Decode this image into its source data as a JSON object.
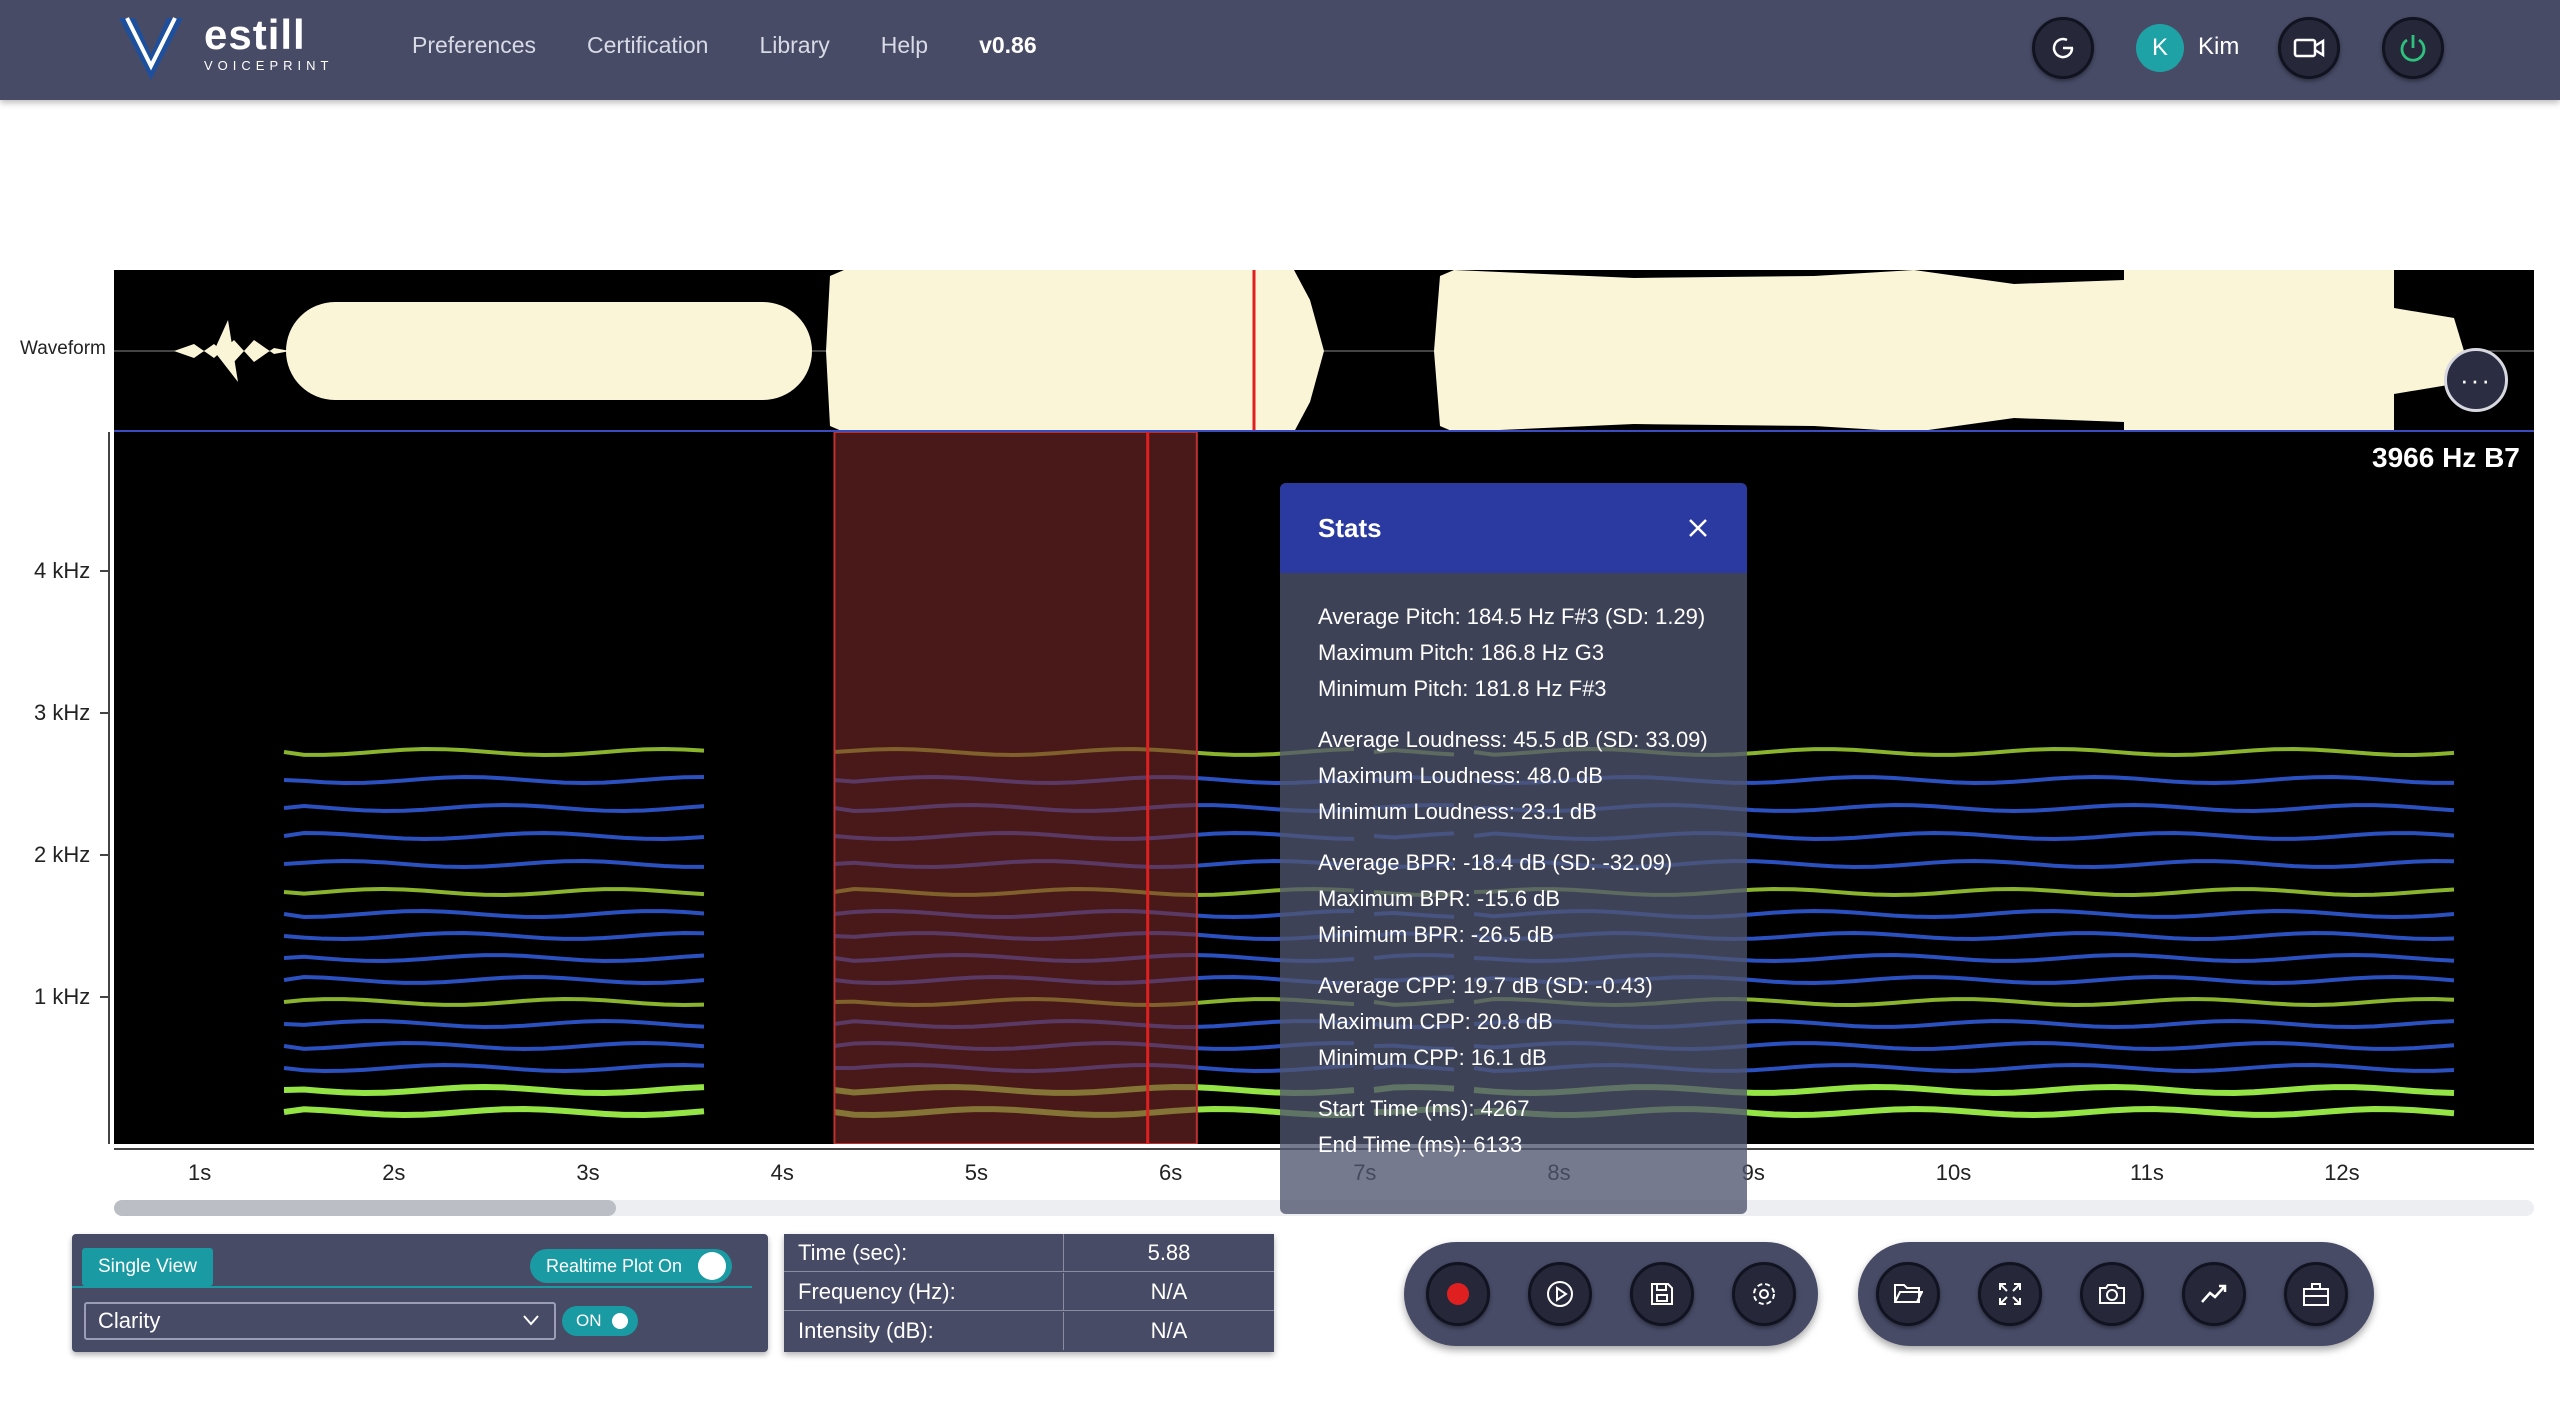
{
  "header": {
    "logo": {
      "brand": "estill",
      "sub": "VOICEPRINT"
    },
    "nav": [
      "Preferences",
      "Certification",
      "Library",
      "Help"
    ],
    "version": "v0.86",
    "user": {
      "initial": "K",
      "name": "Kim"
    },
    "icons": [
      "refresh-icon",
      "video-icon",
      "power-icon"
    ],
    "colors": {
      "header_bg": "#474b66",
      "avatar": "#1fa2a6",
      "power": "#2ec27e"
    }
  },
  "waveform": {
    "label": "Waveform",
    "more_button": "···"
  },
  "spectrogram": {
    "y_ticks": [
      "4 kHz",
      "3 kHz",
      "2 kHz",
      "1 kHz"
    ],
    "x_ticks": [
      "1s",
      "2s",
      "3s",
      "4s",
      "5s",
      "6s",
      "7s",
      "8s",
      "9s",
      "10s",
      "11s",
      "12s"
    ],
    "frequency_readout": "3966 Hz B7",
    "selection": {
      "start_s": 4.267,
      "end_s": 6.133,
      "color": "#7a2a2a"
    },
    "cursor_s": 5.88,
    "cursor_color": "#e02020"
  },
  "stats": {
    "title": "Stats",
    "close_icon": "close-icon",
    "groups": [
      [
        "Average Pitch: 184.5 Hz F#3 (SD: 1.29)",
        "Maximum Pitch: 186.8 Hz G3",
        "Minimum Pitch: 181.8 Hz F#3"
      ],
      [
        "Average Loudness: 45.5 dB (SD: 33.09)",
        "Maximum Loudness: 48.0 dB",
        "Minimum Loudness: 23.1 dB"
      ],
      [
        "Average BPR: -18.4 dB (SD: -32.09)",
        "Maximum BPR: -15.6 dB",
        "Minimum BPR: -26.5 dB"
      ],
      [
        "Average CPP: 19.7 dB (SD: -0.43)",
        "Maximum CPP: 20.8 dB",
        "Minimum CPP: 16.1 dB"
      ],
      [
        "Start Time (ms): 4267",
        "End Time (ms): 6133"
      ]
    ]
  },
  "view_panel": {
    "tab": "Single View",
    "realtime_label": "Realtime Plot On",
    "select_value": "Clarity",
    "toggle_label": "ON"
  },
  "readout": {
    "rows": [
      {
        "label": "Time (sec):",
        "value": "5.88"
      },
      {
        "label": "Frequency (Hz):",
        "value": "N/A"
      },
      {
        "label": "Intensity (dB):",
        "value": "N/A"
      }
    ]
  },
  "controls": {
    "transport": [
      "record-icon",
      "play-icon",
      "save-icon",
      "settings-icon"
    ],
    "tools": [
      "folder-open-icon",
      "expand-icon",
      "camera-icon",
      "trend-icon",
      "toolbox-icon"
    ],
    "record_color": "#e02020"
  }
}
